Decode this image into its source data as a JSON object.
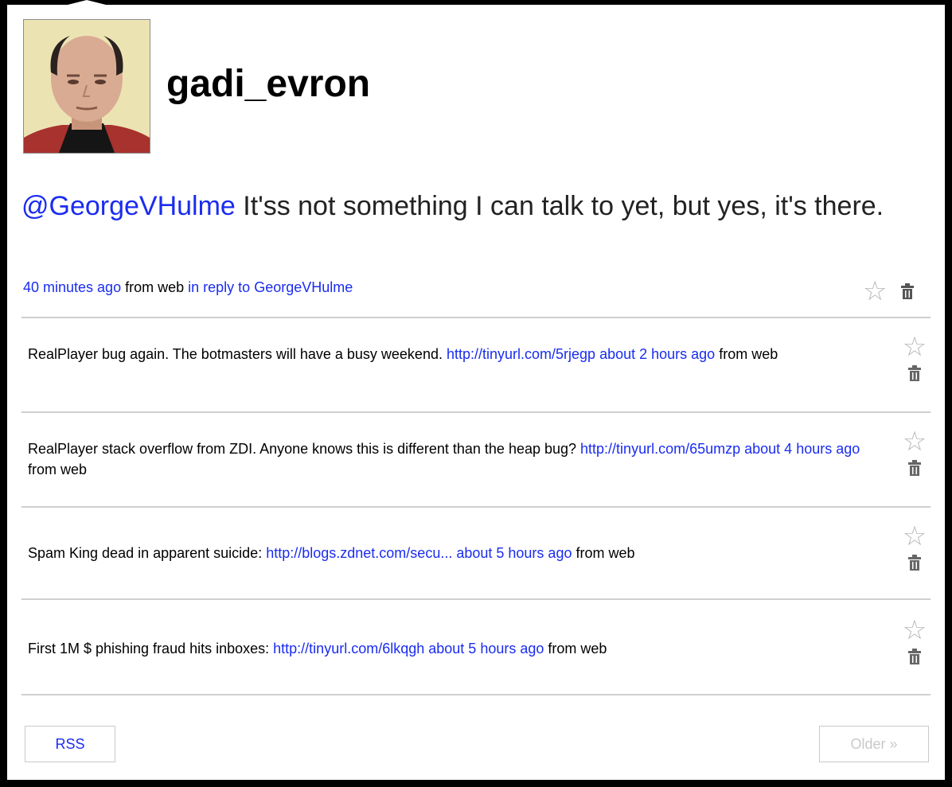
{
  "profile": {
    "username": "gadi_evron",
    "avatar_alt": "gadi_evron"
  },
  "latest": {
    "mention": "@GeorgeVHulme",
    "text": " It'ss not something I can talk to yet, but yes, it's there.",
    "time": "40 minutes ago",
    "source_prefix": " from ",
    "source": "web",
    "reply_prefix": " in reply to ",
    "reply_to": "GeorgeVHulme"
  },
  "icons": {
    "favorite": "star-outline-icon",
    "delete": "trash-icon"
  },
  "tweets": [
    {
      "text": "RealPlayer bug again. The botmasters will have a busy weekend. ",
      "link": "http://tinyurl.com/5rjegp",
      "time": "about 2 hours ago",
      "source_prefix": " from ",
      "source": "web"
    },
    {
      "text": "RealPlayer stack overflow from ZDI. Anyone knows this is different than the heap bug? ",
      "link": "http://tinyurl.com/65umzp",
      "time": "about 4 hours ago",
      "source_prefix": " from ",
      "source": "web"
    },
    {
      "text": "Spam King dead in apparent suicide: ",
      "link": "http://blogs.zdnet.com/secu...",
      "time": "about 5 hours ago",
      "source_prefix": " from ",
      "source": "web"
    },
    {
      "text": "First 1M $ phishing fraud hits inboxes: ",
      "link": "http://tinyurl.com/6lkqgh",
      "time": "about 5 hours ago",
      "source_prefix": " from ",
      "source": "web"
    }
  ],
  "pagination": {
    "rss_label": "RSS",
    "older_label": "Older »"
  },
  "colors": {
    "link": "#1a2cf0",
    "border": "#cfcfcf",
    "disabled": "#c8c8c8",
    "frame": "#000000"
  }
}
